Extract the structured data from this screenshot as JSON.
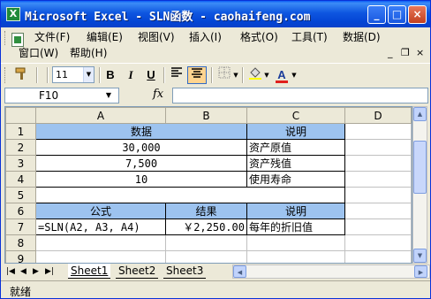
{
  "window": {
    "title": "Microsoft Excel - SLN函数 - caohaifeng.com",
    "icon_text": "X",
    "controls": {
      "minimize": "_",
      "maximize": "□",
      "close": "×"
    }
  },
  "menu": {
    "items": [
      "文件(F)",
      "编辑(E)",
      "视图(V)",
      "插入(I)",
      "格式(O)",
      "工具(T)",
      "数据(D)"
    ],
    "row2": [
      "窗口(W)",
      "帮助(H)"
    ],
    "mdi": {
      "minimize": "_",
      "restore": "❐",
      "close": "×"
    }
  },
  "toolbar": {
    "font_size": "11",
    "bold": "B",
    "italic": "I",
    "underline": "U",
    "font_color_label": "A"
  },
  "formula_bar": {
    "cell_ref": "F10",
    "fx": "fx",
    "content": ""
  },
  "sheet": {
    "columns": [
      "A",
      "B",
      "C",
      "D"
    ],
    "rows": [
      {
        "num": "1",
        "cells": [
          "数据",
          "",
          "说明",
          ""
        ]
      },
      {
        "num": "2",
        "cells": [
          "30,000",
          "",
          "资产原值",
          ""
        ]
      },
      {
        "num": "3",
        "cells": [
          "7,500",
          "",
          "资产残值",
          ""
        ]
      },
      {
        "num": "4",
        "cells": [
          "10",
          "",
          "使用寿命",
          ""
        ]
      },
      {
        "num": "5",
        "cells": [
          "",
          "",
          "",
          ""
        ]
      },
      {
        "num": "6",
        "cells": [
          "公式",
          "结果",
          "说明",
          ""
        ]
      },
      {
        "num": "7",
        "cells": [
          "=SLN(A2, A3, A4)",
          "￥2,250.00",
          "每年的折旧值",
          ""
        ]
      },
      {
        "num": "8",
        "cells": [
          "",
          "",
          "",
          ""
        ]
      },
      {
        "num": "9",
        "cells": [
          "",
          "",
          "",
          ""
        ]
      }
    ]
  },
  "tabs": {
    "nav": [
      "|◀",
      "◀",
      "▶",
      "▶|"
    ],
    "sheets": [
      "Sheet1",
      "Sheet2",
      "Sheet3"
    ],
    "active": "Sheet1"
  },
  "status": {
    "text": "就绪"
  },
  "colors": {
    "title_blue": "#0a5df5",
    "header_blue": "#9dc3ef"
  }
}
